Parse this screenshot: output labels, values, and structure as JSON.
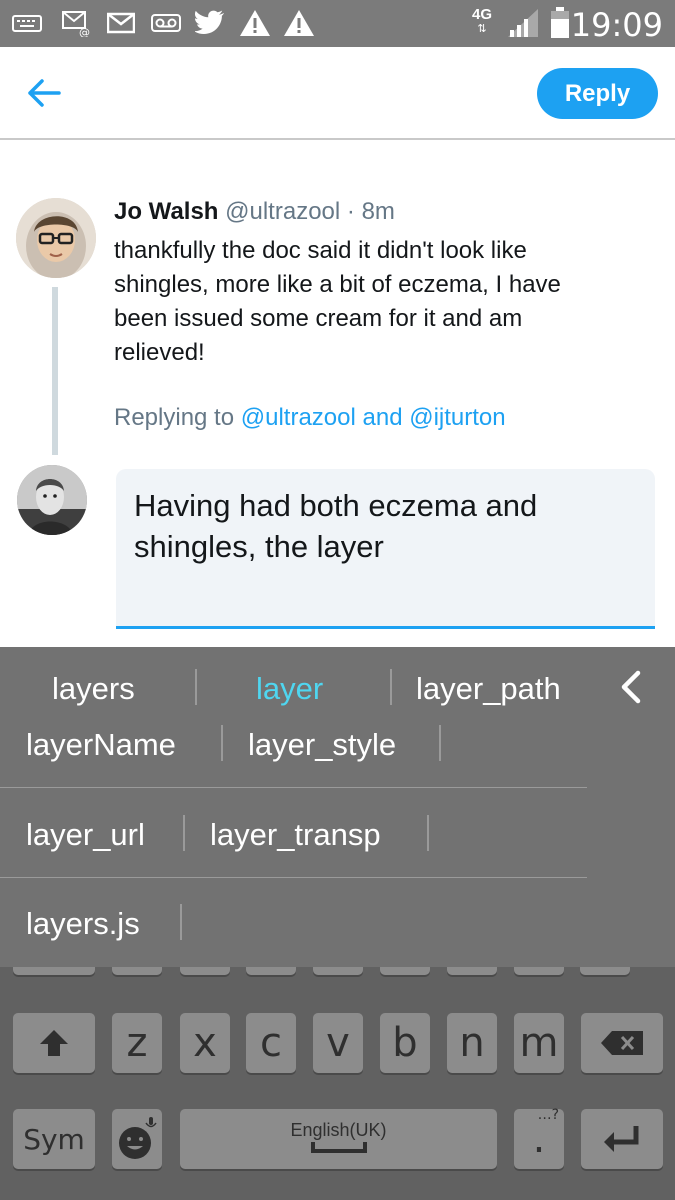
{
  "status_bar": {
    "icons": [
      "keyboard-icon",
      "email-icon",
      "mail-icon",
      "voicemail-icon",
      "twitter-icon",
      "warning-icon",
      "warning-icon"
    ],
    "network": "4G",
    "time": "19:09"
  },
  "header": {
    "reply_label": "Reply"
  },
  "tweet": {
    "name": "Jo Walsh",
    "handle": "@ultrazool",
    "separator": "·",
    "time": "8m",
    "text": "thankfully the doc said it didn't look like shingles, more like a bit of eczema, I have been issued some cream for it and am relieved!",
    "replying_prefix": "Replying to",
    "replying_mentions": "@ultrazool and @ijturton"
  },
  "compose": {
    "text": "Having had both eczema and shingles, the layer"
  },
  "suggestions": {
    "row1": [
      "layers",
      "layer",
      "layer_path"
    ],
    "row2": [
      "layerName",
      "layer_style"
    ],
    "row3": [
      "layer_url",
      "layer_transp"
    ],
    "row4": [
      "layers.js"
    ],
    "active": "layer"
  },
  "keyboard": {
    "row_letters": [
      "z",
      "x",
      "c",
      "v",
      "b",
      "n",
      "m"
    ],
    "sym_label": "Sym",
    "space_label": "English(UK)",
    "period": ".",
    "period_hint": "…?"
  },
  "colors": {
    "accent": "#1da1f2",
    "suggestion_active": "#4fd6f0",
    "keyboard_bg": "#616161",
    "suggestion_bg": "#727272"
  }
}
